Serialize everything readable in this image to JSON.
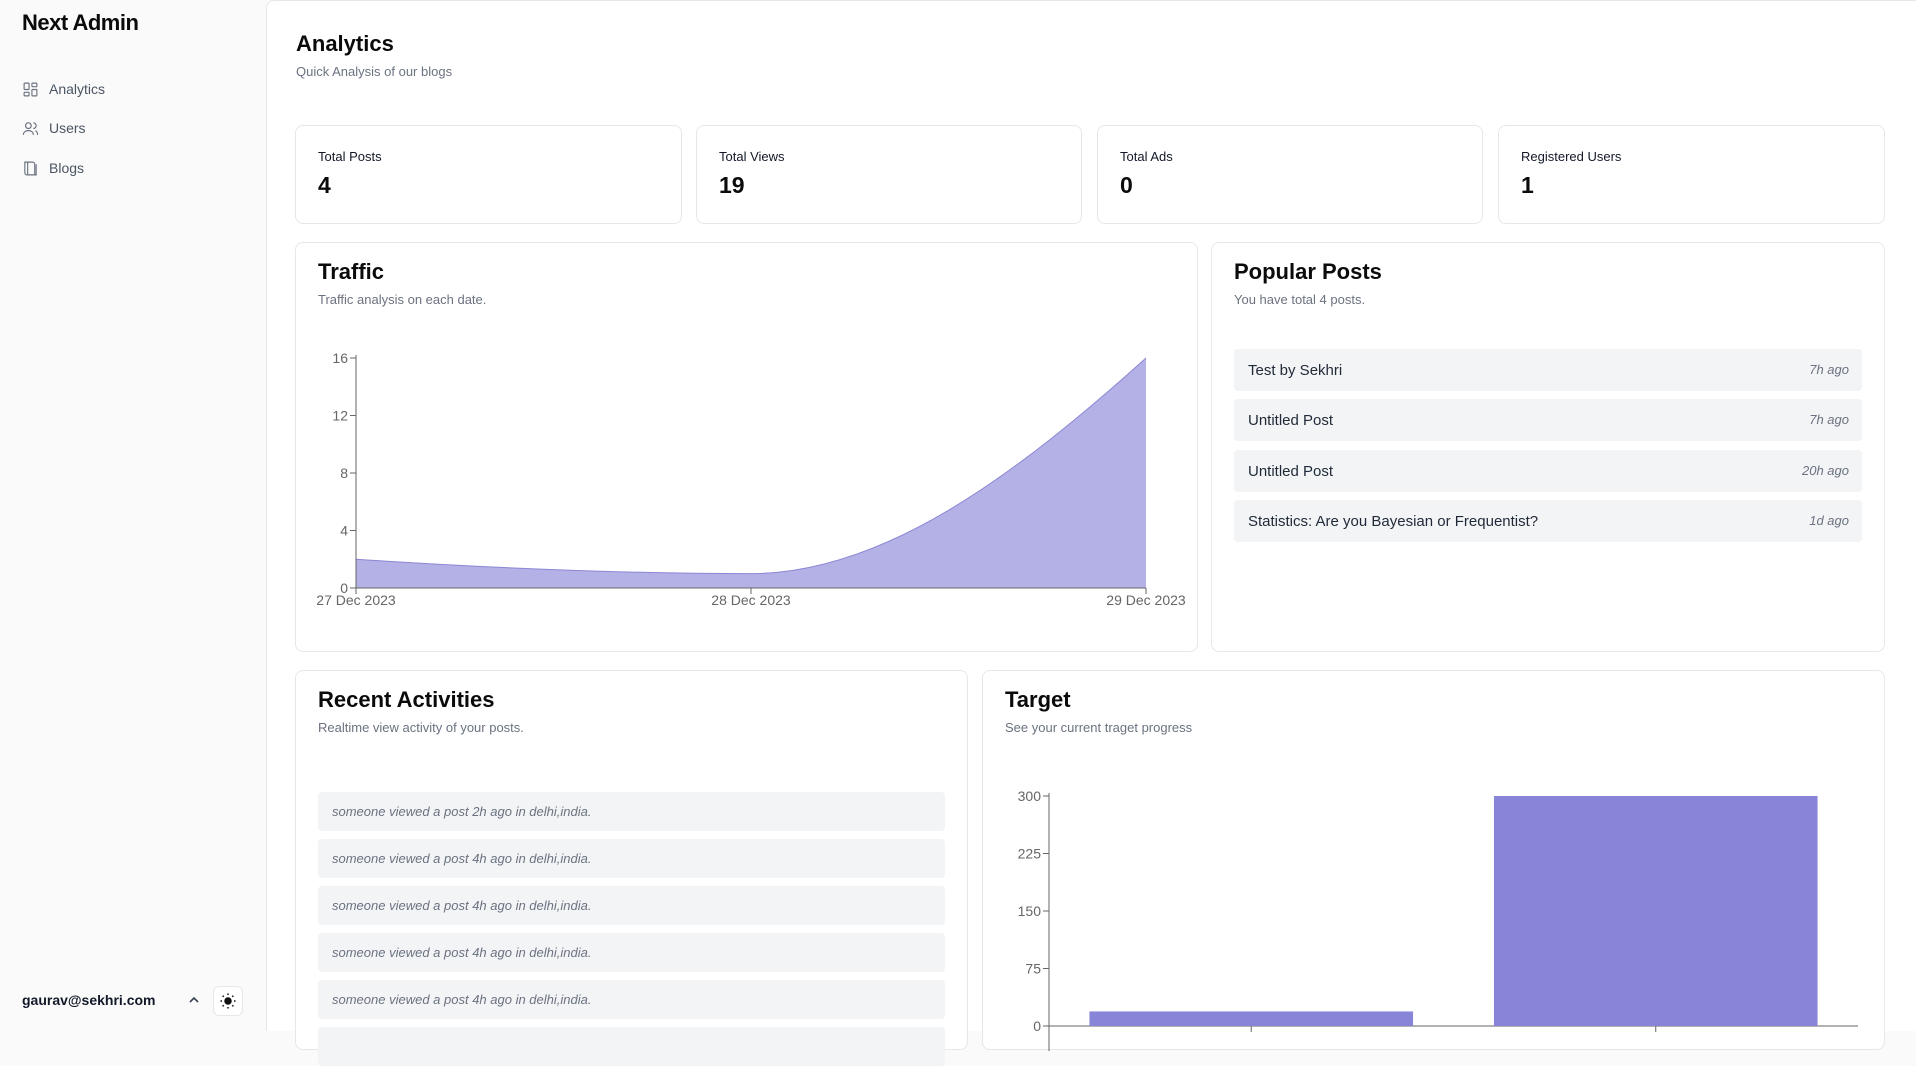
{
  "sidebar": {
    "brand": "Next Admin",
    "items": [
      {
        "label": "Analytics",
        "icon": "dashboard-icon"
      },
      {
        "label": "Users",
        "icon": "users-icon"
      },
      {
        "label": "Blogs",
        "icon": "book-icon"
      }
    ],
    "user_email": "gaurav@sekhri.com"
  },
  "header": {
    "title": "Analytics",
    "subtitle": "Quick Analysis of our blogs"
  },
  "stats": [
    {
      "label": "Total Posts",
      "value": "4"
    },
    {
      "label": "Total Views",
      "value": "19"
    },
    {
      "label": "Total Ads",
      "value": "0"
    },
    {
      "label": "Registered Users",
      "value": "1"
    }
  ],
  "traffic": {
    "title": "Traffic",
    "subtitle": "Traffic analysis on each date."
  },
  "popular": {
    "title": "Popular Posts",
    "subtitle": "You have total 4 posts.",
    "posts": [
      {
        "title": "Test by Sekhri",
        "time": "7h ago"
      },
      {
        "title": "Untitled Post",
        "time": "7h ago"
      },
      {
        "title": "Untitled Post",
        "time": "20h ago"
      },
      {
        "title": "Statistics: Are you Bayesian or Frequentist?",
        "time": "1d ago"
      }
    ]
  },
  "activities": {
    "title": "Recent Activities",
    "subtitle": "Realtime view activity of your posts.",
    "items": [
      "someone viewed a post 2h ago in delhi,india.",
      "someone viewed a post 4h ago in delhi,india.",
      "someone viewed a post 4h ago in delhi,india.",
      "someone viewed a post 4h ago in delhi,india.",
      "someone viewed a post 4h ago in delhi,india."
    ]
  },
  "target": {
    "title": "Target",
    "subtitle": "See your current traget progress"
  },
  "colors": {
    "area_fill": "#b4b1e6",
    "area_stroke": "#8b87d4",
    "bar_fill": "#8884d8"
  },
  "chart_data": [
    {
      "type": "area",
      "x": [
        "27 Dec 2023",
        "28 Dec 2023",
        "29 Dec 2023"
      ],
      "series": [
        {
          "values": [
            2,
            1,
            16
          ]
        }
      ],
      "ylim": [
        0,
        16
      ],
      "yticks": [
        0,
        4,
        8,
        12,
        16
      ],
      "grid": false
    },
    {
      "type": "bar",
      "categories": [
        "",
        ""
      ],
      "values": [
        19,
        300
      ],
      "ylim": [
        0,
        300
      ],
      "yticks": [
        0,
        75,
        150,
        225,
        300
      ],
      "grid": false
    }
  ]
}
